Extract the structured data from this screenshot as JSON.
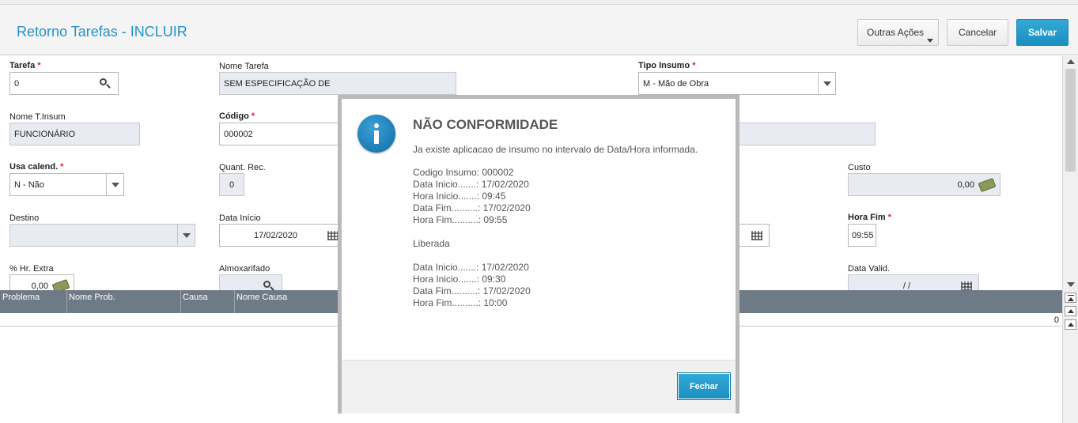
{
  "header": {
    "title": "Retorno Tarefas - INCLUIR",
    "outras_acoes": "Outras Ações",
    "cancelar": "Cancelar",
    "salvar": "Salvar"
  },
  "form": {
    "tarefa": {
      "label": "Tarefa",
      "value": "0"
    },
    "nome_tarefa": {
      "label": "Nome Tarefa",
      "value": "SEM ESPECIFICAÇÃO DE"
    },
    "tipo_insumo": {
      "label": "Tipo Insumo",
      "value": "M - Mão de Obra"
    },
    "nome_t_insum": {
      "label": "Nome T.Insum",
      "value": "FUNCIONÁRIO"
    },
    "codigo": {
      "label": "Código",
      "value": "000002"
    },
    "usa_calend": {
      "label": "Usa calend.",
      "value": "N - Não"
    },
    "quant_rec": {
      "label": "Quant. Rec.",
      "value": "0"
    },
    "custo": {
      "label": "Custo",
      "value": "0,00"
    },
    "destino": {
      "label": "Destino",
      "value": ""
    },
    "data_inicio": {
      "label": "Data Início",
      "value": "17/02/2020"
    },
    "hora_fim": {
      "label": "Hora Fim",
      "value": "09:55"
    },
    "hr_extra": {
      "label": "% Hr. Extra",
      "value": "0,00"
    },
    "almoxarifado": {
      "label": "Almoxarifado",
      "value": ""
    },
    "data_valid": {
      "label": "Data Valid.",
      "value": "/ /"
    },
    "required_mark": "*"
  },
  "grid": {
    "columns": [
      "Problema",
      "Nome Prob.",
      "Causa",
      "Nome Causa"
    ],
    "count": "0"
  },
  "modal": {
    "title": "NÃO CONFORMIDADE",
    "message": "Ja existe aplicacao de insumo no intervalo de Data/Hora informada.",
    "lines": [
      "Codigo Insumo: 000002",
      "Data Inicio.......: 17/02/2020",
      "Hora Inicio.......: 09:45",
      "Data Fim..........: 17/02/2020",
      "Hora Fim..........: 09:55",
      "Liberada",
      "Data Inicio.......: 17/02/2020",
      "Hora Inicio.......: 09:30",
      "Data Fim..........: 17/02/2020",
      "Hora Fim..........: 10:00"
    ],
    "close_label": "Fechar",
    "icon": "info-icon"
  },
  "colors": {
    "accent": "#2591c9",
    "primary_button": "#1b8fc0",
    "required": "#d9262c",
    "grid_header": "#6e7b86"
  }
}
